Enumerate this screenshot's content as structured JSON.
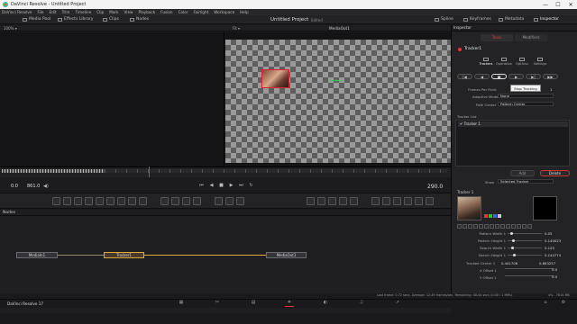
{
  "window": {
    "title": "DaVinci Resolve - Untitled Project",
    "minimize": "—",
    "maximize": "☐",
    "close": "✕"
  },
  "menu": [
    "DaVinci Resolve",
    "File",
    "Edit",
    "Trim",
    "Timeline",
    "Clip",
    "Mark",
    "View",
    "Playback",
    "Fusion",
    "Color",
    "Fairlight",
    "Workspace",
    "Help"
  ],
  "toolbar": {
    "media_pool": "Media Pool",
    "effects_library": "Effects Library",
    "clips": "Clips",
    "nodes": "Nodes",
    "project_title": "Untitled Project",
    "edited": "Edited",
    "spline": "Spline",
    "keyframes": "Keyframes",
    "metadata": "Metadata",
    "inspector": "Inspector"
  },
  "viewer": {
    "zoom_left": "100% ▾",
    "zoom_right": "Fit ▾",
    "right_title": "MediaOut1"
  },
  "transport": {
    "start": "0.0",
    "in": "861.0",
    "end": "290.0"
  },
  "nodes": {
    "header": "Nodes",
    "items": [
      {
        "label": "MediaIn1"
      },
      {
        "label": "Tracker1"
      },
      {
        "label": "MediaOut1"
      }
    ]
  },
  "status": {
    "text": "Last frame: 0.72 secs, Average: 12.49 frames/sec, Remaining: 48.44 secs (0:00 / 1 MMs)",
    "ram": "4%  -  7814 MB"
  },
  "resolve_version": "DaVinci Resolve 17",
  "inspector": {
    "title": "Inspector",
    "tab_tools": "Tools",
    "tab_modifiers": "Modifiers",
    "tool_name": "Tracker1",
    "subtabs": [
      "Trackers",
      "Operation",
      "Options",
      "Settings"
    ],
    "tooltip": "Stop Tracking",
    "params": {
      "frames_per_point_label": "Frames Per Point",
      "frames_per_point_value": "1",
      "adaptive_mode_label": "Adaptive Mode",
      "adaptive_mode_value": "None",
      "path_center_label": "Path Center",
      "path_center_value": "Pattern Center"
    },
    "tracker_list_label": "Tracker List",
    "tracker_list_item": "✔  Tracker 1",
    "add": "Add",
    "delete": "Delete",
    "show_label": "Show",
    "show_value": "Selected Tracker",
    "tracker_label": "Tracker 1",
    "sliders": [
      {
        "label": "Pattern Width 1",
        "value": "0.05",
        "fraction": 0.12
      },
      {
        "label": "Pattern Height 1",
        "value": "0.140023",
        "fraction": 0.18
      },
      {
        "label": "Search Width 1",
        "value": "0.125",
        "fraction": 0.15
      },
      {
        "label": "Search Height 1",
        "value": "0.144774",
        "fraction": 0.2
      }
    ],
    "tracked_center": {
      "label": "Tracked Center 1",
      "x": "0.441706",
      "y": "0.663257"
    },
    "x_offset": {
      "label": "X Offset 1",
      "value": "0.0"
    },
    "y_offset": {
      "label": "Y Offset 1",
      "value": "0.0"
    }
  }
}
